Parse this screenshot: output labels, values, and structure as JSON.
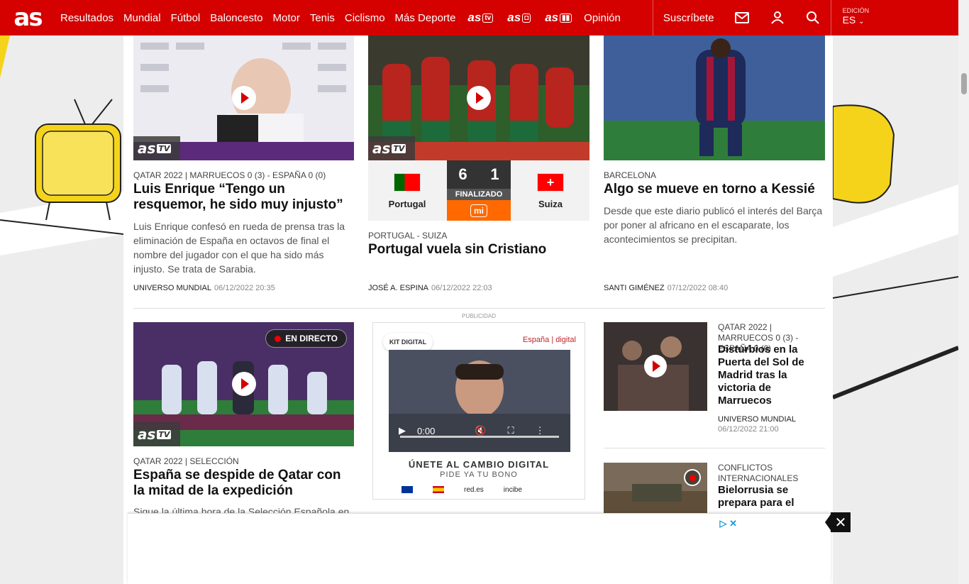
{
  "header": {
    "logo": "as",
    "nav": [
      "Resultados",
      "Mundial",
      "Fútbol",
      "Baloncesto",
      "Motor",
      "Tenis",
      "Ciclismo",
      "Más Deporte"
    ],
    "brands": [
      {
        "name": "as",
        "tag": "tv"
      },
      {
        "name": "as",
        "tag": "◘"
      },
      {
        "name": "as",
        "tag": "▮▮"
      }
    ],
    "opinion": "Opinión",
    "subscribe": "Suscríbete",
    "edition_label": "EDICIÓN",
    "edition_value": "ES"
  },
  "articles": [
    {
      "kicker": "QATAR 2022 | MARRUECOS 0 (3) - ESPAÑA 0 (0)",
      "headline": "Luis Enrique “Tengo un resquemor, he sido muy injusto”",
      "summary": "Luis Enrique confesó en rueda de prensa tras la eliminación de España en octavos de final el nombre del jugador con el que ha sido más injusto. Se trata de Sarabia.",
      "author": "UNIVERSO MUNDIAL",
      "date": "06/12/2022",
      "time": "20:35"
    },
    {
      "kicker": "PORTUGAL - SUIZA",
      "headline": "Portugal vuela sin Cristiano",
      "author": "JOSÉ A. ESPINA",
      "date": "06/12/2022",
      "time": "22:03"
    },
    {
      "kicker": "BARCELONA",
      "headline": "Algo se mueve en torno a Kessié",
      "summary": "Desde que este diario publicó el interés del Barça por poner al africano en el escaparate, los acontecimientos se precipitan.",
      "author": "SANTI GIMÉNEZ",
      "date": "07/12/2022",
      "time": "08:40"
    },
    {
      "kicker": "QATAR 2022 | SELECCIÓN",
      "headline": "España se despide de Qatar con la mitad de la expedición",
      "summary": "Sigue la última hora de la Selección Española en",
      "live": "EN DIRECTO"
    },
    {
      "kicker": "QATAR 2022 | MARRUECOS 0 (3) - ESPAÑA 0 (0)",
      "headline": "Disturbios en la Puerta del Sol de Madrid tras la victoria de Marruecos",
      "author": "UNIVERSO MUNDIAL",
      "date": "06/12/2022",
      "time": "21:00"
    },
    {
      "kicker": "CONFLICTOS INTERNACIONALES",
      "headline": "Bielorrusia se prepara para el"
    }
  ],
  "match": {
    "home": "Portugal",
    "away": "Suiza",
    "home_score": "6",
    "away_score": "1",
    "status": "FINALIZADO",
    "sponsor": "mi"
  },
  "astv_label": "as",
  "astv_tag": "TV",
  "ad": {
    "label": "PUBLICIDAD",
    "brand": "KIT DIGITAL",
    "partner": "España | digital",
    "time": "0:00",
    "slogan": "ÚNETE AL CAMBIO DIGITAL",
    "cta": "PIDE YA TU BONO",
    "footer_logos": [
      "red.es",
      "incibe"
    ]
  },
  "colors": {
    "brand_red": "#d50000",
    "sponsor_orange": "#ff6900"
  }
}
